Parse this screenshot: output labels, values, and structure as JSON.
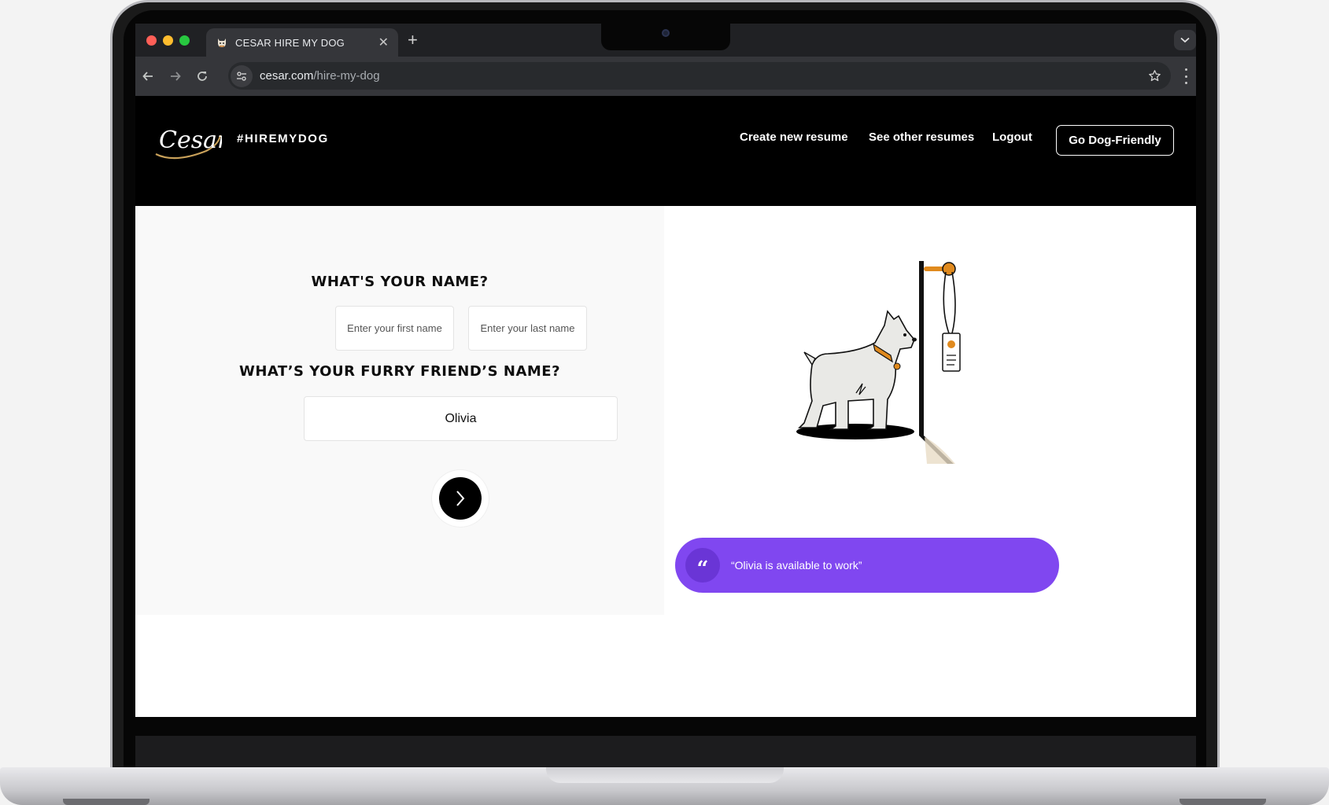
{
  "browser": {
    "tab_title": "CESAR HIRE MY DOG",
    "url_host": "cesar.com",
    "url_path": "/hire-my-dog"
  },
  "site": {
    "logo_text": "Cesar",
    "hashtag": "#HIREMYDOG",
    "nav": {
      "create": "Create new resume",
      "others": "See other resumes",
      "logout": "Logout",
      "cta": "Go Dog-Friendly"
    },
    "form": {
      "name_question": "WHAT'S YOUR NAME?",
      "first_name_placeholder": "Enter your first name",
      "last_name_placeholder": "Enter your last name",
      "pet_question": "WHAT’S YOUR FURRY FRIEND’S NAME?",
      "pet_name_value": "Olivia"
    },
    "quote": {
      "mark": "“",
      "text": "“Olivia is available to work”"
    }
  },
  "colors": {
    "accent_purple": "#8047f0",
    "collar_orange": "#e08a1e",
    "header_bg": "#000000"
  },
  "icons": [
    "back-arrow-icon",
    "forward-arrow-icon",
    "reload-icon",
    "site-info-icon",
    "star-icon",
    "chevron-right-icon",
    "quote-icon"
  ]
}
